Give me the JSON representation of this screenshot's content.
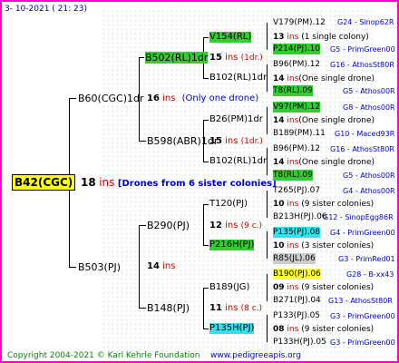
{
  "date": "3- 10-2021 ( 21: 23)",
  "root": {
    "label": "B42(CGC)",
    "count": "18",
    "ins": "ins",
    "note": "[Drones from 6 sister colonies]"
  },
  "gen1": [
    {
      "label": "B60(CGC)1dr",
      "count": "16",
      "ins": "ins",
      "note": "(Only one drone)"
    },
    {
      "label": "B503(PJ)",
      "count": "14",
      "ins": "ins",
      "note": ""
    }
  ],
  "gen2": [
    {
      "label": "B502(RL)1dr",
      "count": "15",
      "ins": "ins",
      "note": "(1dr.)"
    },
    {
      "label": "B598(ABR)1dr",
      "count": "15",
      "ins": "ins",
      "note": "(1dr.)"
    },
    {
      "label": "B290(PJ)",
      "count": "12",
      "ins": "ins",
      "note": "(9 c.)"
    },
    {
      "label": "B148(PJ)",
      "count": "11",
      "ins": "ins",
      "note": "(8 c.)"
    }
  ],
  "gen3": [
    {
      "label": "V154(RL)",
      "count": "13",
      "ins": "ins",
      "note": "(1 single colony)"
    },
    {
      "label": "B102(RL)1dr",
      "count": "14",
      "ins": "ins",
      "note": "(One single drone)"
    },
    {
      "label": "B26(PM)1dr",
      "count": "14",
      "ins": "ins",
      "note": "(One single drone)"
    },
    {
      "label": "B102(RL)1dr",
      "count": "14",
      "ins": "ins",
      "note": "(One single drone)"
    },
    {
      "label": "T120(PJ)",
      "count": "10",
      "ins": "ins",
      "note": "(9 sister colonies)"
    },
    {
      "label": "P216H(PJ)",
      "count": "10",
      "ins": "ins",
      "note": "(3 sister colonies)"
    },
    {
      "label": "B189(JG)",
      "count": "09",
      "ins": "ins",
      "note": "(9 sister colonies)"
    },
    {
      "label": "P135H(PJ)",
      "count": "08",
      "ins": "ins",
      "note": "(9 sister colonies)"
    }
  ],
  "gen4": [
    {
      "name": "V179(PM).12",
      "line": "G24 - Sinop62R"
    },
    {
      "name": "P214(PJ).10",
      "line": "G5 - PrimGreen00"
    },
    {
      "name": "B96(PM).12",
      "line": "G16 - AthosSt80R"
    },
    {
      "name": "T8(RL).09",
      "line": "G5 - Athos00R"
    },
    {
      "name": "V97(PM).12",
      "line": "G8 - Athos00R"
    },
    {
      "name": "B189(PM).11",
      "line": "G10 - Maced93R"
    },
    {
      "name": "B96(PM).12",
      "line": "G16 - AthosSt80R"
    },
    {
      "name": "T8(RL).09",
      "line": "G5 - Athos00R"
    },
    {
      "name": "T265(PJ).07",
      "line": "G4 - Athos00R"
    },
    {
      "name": "B213H(PJ).06",
      "line": "G12 - SinopEgg86R"
    },
    {
      "name": "P135(PJ).08",
      "line": "G4 - PrimGreen00"
    },
    {
      "name": "R85(JL).06",
      "line": "G3 - PrimRed01"
    },
    {
      "name": "B190(PJ).06",
      "line": "G28 - B-xx43"
    },
    {
      "name": "B271(PJ).04",
      "line": "G13 - AthosSt80R"
    },
    {
      "name": "P133(PJ).05",
      "line": "G3 - PrimGreen00"
    },
    {
      "name": "P133H(PJ).05",
      "line": "G3 - PrimGreen00"
    }
  ],
  "footer": {
    "copyright": "Copyright 2004-2021 © Karl Kehrle Foundation",
    "site": "www.pedigreeapis.org"
  },
  "colors": {
    "border": "#ff00cc",
    "highlight_green": "#33cc33",
    "highlight_cyan": "#33e0f0",
    "highlight_yellow": "#ffff33",
    "ins_red": "#cc0000"
  }
}
